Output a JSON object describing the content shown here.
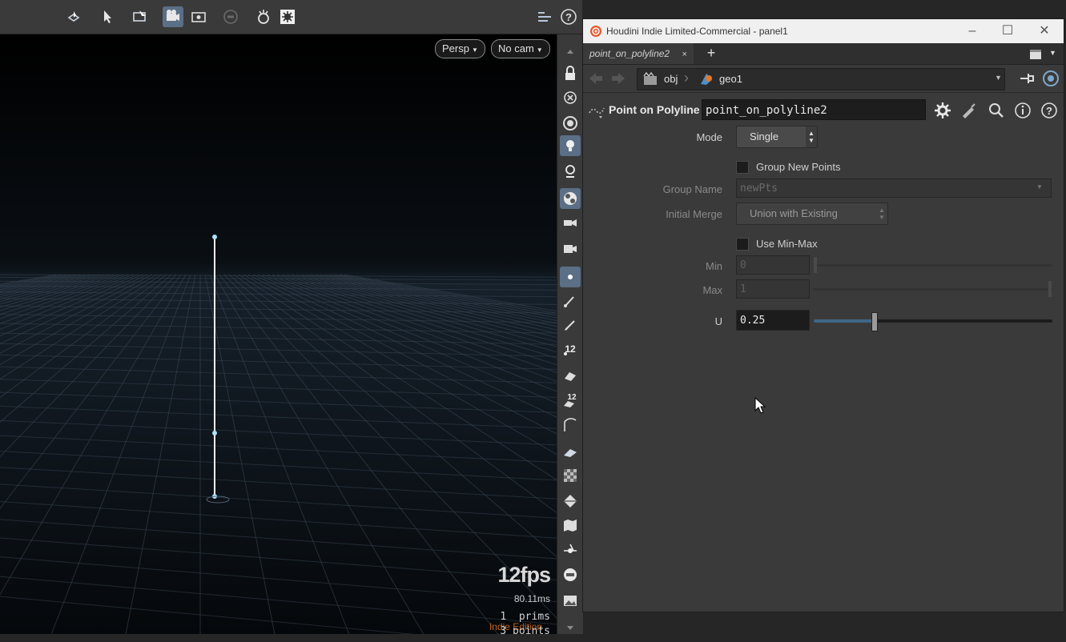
{
  "toolbar": {
    "icons": [
      "select-icon",
      "move-icon",
      "transform-handle-icon",
      "camera-icon",
      "display-options-icon",
      "stop-icon",
      "snapshot-icon",
      "render-settings-icon",
      "layout-icon",
      "help-icon"
    ]
  },
  "viewport": {
    "camera_menu": "Persp",
    "cam_menu": "No cam",
    "fps": "12fps",
    "frame_time": "80.11ms",
    "prims": "1  prims",
    "points": "3 points",
    "edition": "Indie Edition"
  },
  "panel": {
    "window_title": "Houdini Indie Limited-Commercial - panel1",
    "tab_label": "point_on_polyline2",
    "tab_close": "×",
    "tab_add": "+",
    "path": [
      "obj",
      "geo1"
    ],
    "node_type": "Point on Polyline",
    "node_name": "point_on_polyline2"
  },
  "params": {
    "mode_label": "Mode",
    "mode_value": "Single",
    "group_new_points_label": "Group New Points",
    "group_new_points_checked": false,
    "group_name_label": "Group Name",
    "group_name_value": "newPts",
    "initial_merge_label": "Initial Merge",
    "initial_merge_value": "Union with Existing",
    "use_minmax_label": "Use Min-Max",
    "use_minmax_checked": false,
    "min_label": "Min",
    "min_value": "0",
    "max_label": "Max",
    "max_value": "1",
    "u_label": "U",
    "u_value": "0.25",
    "u_slider_fraction": 0.25
  },
  "colors": {
    "active_button": "#5b6f86",
    "edition_text": "#e07020",
    "slider_fill": "#3f6788"
  }
}
